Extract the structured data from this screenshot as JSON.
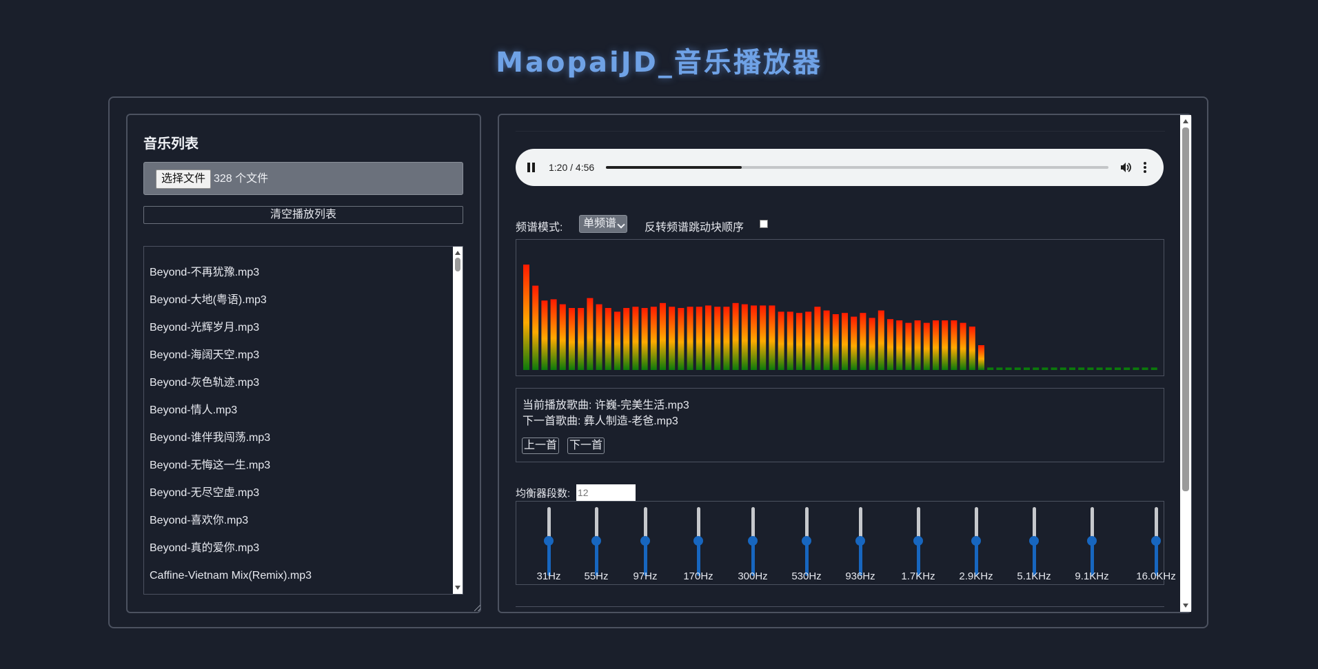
{
  "app": {
    "title": "MaopaiJD_音乐播放器"
  },
  "playlist_panel": {
    "heading": "音乐列表",
    "file_input": {
      "button_label": "选择文件",
      "status": "328 个文件"
    },
    "clear_button": "清空播放列表",
    "items": [
      "Beyond-不再犹豫.mp3",
      "Beyond-大地(粤语).mp3",
      "Beyond-光辉岁月.mp3",
      "Beyond-海阔天空.mp3",
      "Beyond-灰色轨迹.mp3",
      "Beyond-情人.mp3",
      "Beyond-谁伴我闯荡.mp3",
      "Beyond-无悔这一生.mp3",
      "Beyond-无尽空虚.mp3",
      "Beyond-喜欢你.mp3",
      "Beyond-真的爱你.mp3",
      "Caffine-Vietnam Mix(Remix).mp3"
    ]
  },
  "player": {
    "time": "1:20 / 4:56",
    "progress_fraction": 0.27,
    "pause_icon": "pause-icon",
    "volume_icon": "volume-icon",
    "menu_icon": "more-vertical-icon"
  },
  "spectrum_controls": {
    "mode_label": "频谱模式:",
    "mode_value": "单频谱",
    "reverse_label": "反转频谱跳动块顺序",
    "reverse_checked": false
  },
  "spectrum_levels": [
    0.85,
    0.68,
    0.56,
    0.57,
    0.53,
    0.5,
    0.5,
    0.58,
    0.53,
    0.5,
    0.47,
    0.5,
    0.51,
    0.5,
    0.51,
    0.54,
    0.51,
    0.5,
    0.51,
    0.51,
    0.52,
    0.51,
    0.51,
    0.54,
    0.53,
    0.52,
    0.52,
    0.52,
    0.47,
    0.47,
    0.46,
    0.47,
    0.51,
    0.48,
    0.45,
    0.46,
    0.43,
    0.46,
    0.42,
    0.48,
    0.41,
    0.4,
    0.38,
    0.4,
    0.38,
    0.4,
    0.4,
    0.4,
    0.38,
    0.35,
    0.2,
    0.02,
    0.02,
    0.02,
    0.02,
    0.02,
    0.02,
    0.02,
    0.02,
    0.02,
    0.02,
    0.02,
    0.02,
    0.02,
    0.02,
    0.02,
    0.02,
    0.02,
    0.02,
    0.02
  ],
  "now_playing": {
    "current": "当前播放歌曲: 许巍-完美生活.mp3",
    "next": "下一首歌曲: 彝人制造-老爸.mp3",
    "prev_button": "上一首",
    "next_button": "下一首"
  },
  "equalizer": {
    "count_label": "均衡器段数:",
    "count_placeholder": "12",
    "bands": [
      "31Hz",
      "55Hz",
      "97Hz",
      "170Hz",
      "300Hz",
      "530Hz",
      "936Hz",
      "1.7KHz",
      "2.9KHz",
      "5.1KHz",
      "9.1KHz",
      "16.0KHz"
    ],
    "gain_levels": [
      0,
      0,
      0,
      0,
      0,
      0,
      0,
      0,
      0,
      0,
      0,
      0
    ]
  },
  "colors": {
    "background": "#1a1f2b",
    "title": "#6fa2e6",
    "spectrum_top": "#ff1a00",
    "spectrum_mid": "#ffaa00",
    "spectrum_bottom": "#0b7a0b",
    "eq_accent": "#1766bf"
  }
}
